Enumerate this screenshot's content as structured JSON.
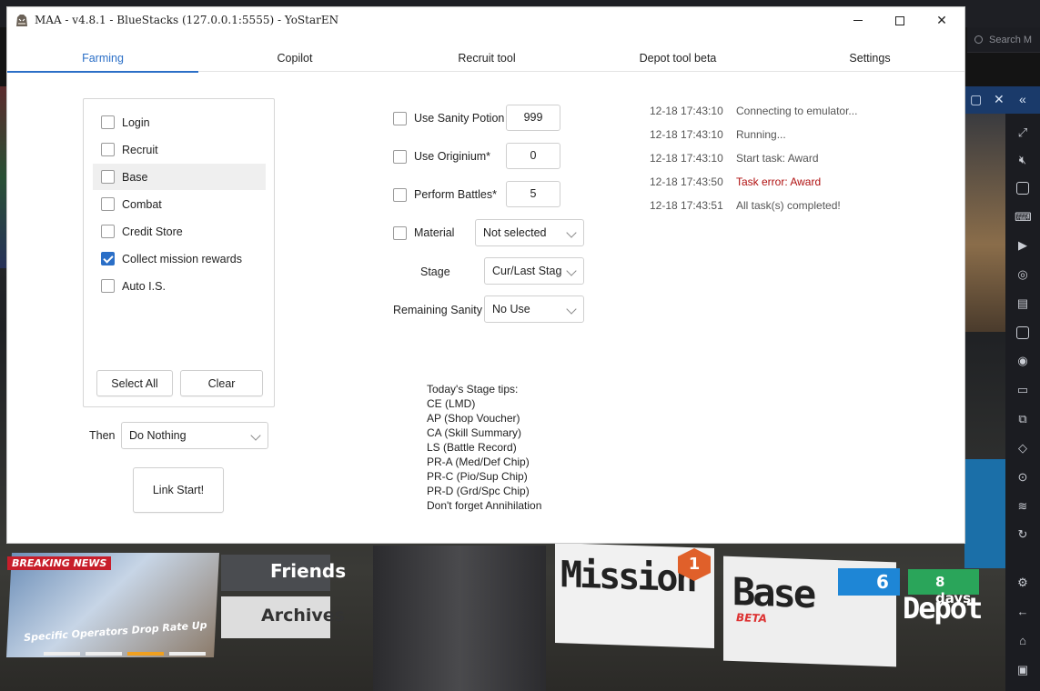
{
  "window": {
    "title": "MAA - v4.8.1 - BlueStacks (127.0.0.1:5555) - YoStarEN",
    "controls": {
      "minimize": "minimize-icon",
      "maximize": "maximize-icon",
      "close": "close-icon"
    }
  },
  "tabs": [
    {
      "label": "Farming",
      "active": true
    },
    {
      "label": "Copilot",
      "active": false
    },
    {
      "label": "Recruit tool",
      "active": false
    },
    {
      "label": "Depot tool beta",
      "active": false
    },
    {
      "label": "Settings",
      "active": false
    }
  ],
  "tasks": [
    {
      "label": "Login",
      "checked": false
    },
    {
      "label": "Recruit",
      "checked": false
    },
    {
      "label": "Base",
      "checked": false,
      "highlighted": true
    },
    {
      "label": "Combat",
      "checked": false
    },
    {
      "label": "Credit Store",
      "checked": false
    },
    {
      "label": "Collect mission rewards",
      "checked": true
    },
    {
      "label": "Auto I.S.",
      "checked": false
    }
  ],
  "task_buttons": {
    "select_all": "Select All",
    "clear": "Clear"
  },
  "then": {
    "label": "Then",
    "value": "Do Nothing"
  },
  "link_start": "Link Start!",
  "options": {
    "sanity_potion": {
      "label": "Use Sanity Potion",
      "value": "999",
      "checked": false
    },
    "originium": {
      "label": "Use Originium*",
      "value": "0",
      "checked": false
    },
    "battles": {
      "label": "Perform Battles*",
      "value": "5",
      "checked": false
    },
    "material": {
      "label": "Material",
      "value": "Not selected",
      "checked": false
    },
    "stage": {
      "label": "Stage",
      "value": "Cur/Last Stag"
    },
    "remaining_sanity": {
      "label": "Remaining Sanity",
      "value": "No Use"
    }
  },
  "stage_tips": [
    "Today's Stage tips:",
    "CE (LMD)",
    "AP (Shop Voucher)",
    "CA (Skill Summary)",
    "LS (Battle Record)",
    "PR-A (Med/Def Chip)",
    "PR-C (Pio/Sup Chip)",
    "PR-D (Grd/Spc Chip)",
    "Don't forget Annihilation"
  ],
  "log": [
    {
      "time": "12-18  17:43:10",
      "message": "Connecting to emulator...",
      "error": false
    },
    {
      "time": "12-18  17:43:10",
      "message": "Running...",
      "error": false
    },
    {
      "time": "12-18  17:43:10",
      "message": "Start task: Award",
      "error": false
    },
    {
      "time": "12-18  17:43:50",
      "message": "Task error: Award",
      "error": true
    },
    {
      "time": "12-18  17:43:51",
      "message": "All task(s) completed!",
      "error": false
    }
  ],
  "colors": {
    "accent": "#2b6fc7",
    "error": "#b01010",
    "checkbox_on": "#2b6fc7"
  },
  "emulator": {
    "search_placeholder": "Search M",
    "news_tag": "BREAKING NEWS",
    "news_caption": "Specific Operators Drop Rate Up",
    "friends": "Friends",
    "archives": "Archives",
    "mission": "Mission",
    "mission_badge": "1",
    "base": "Base",
    "base_tag": "BETA",
    "notification_count": "6",
    "days": "8 days",
    "depot": "Depot"
  }
}
